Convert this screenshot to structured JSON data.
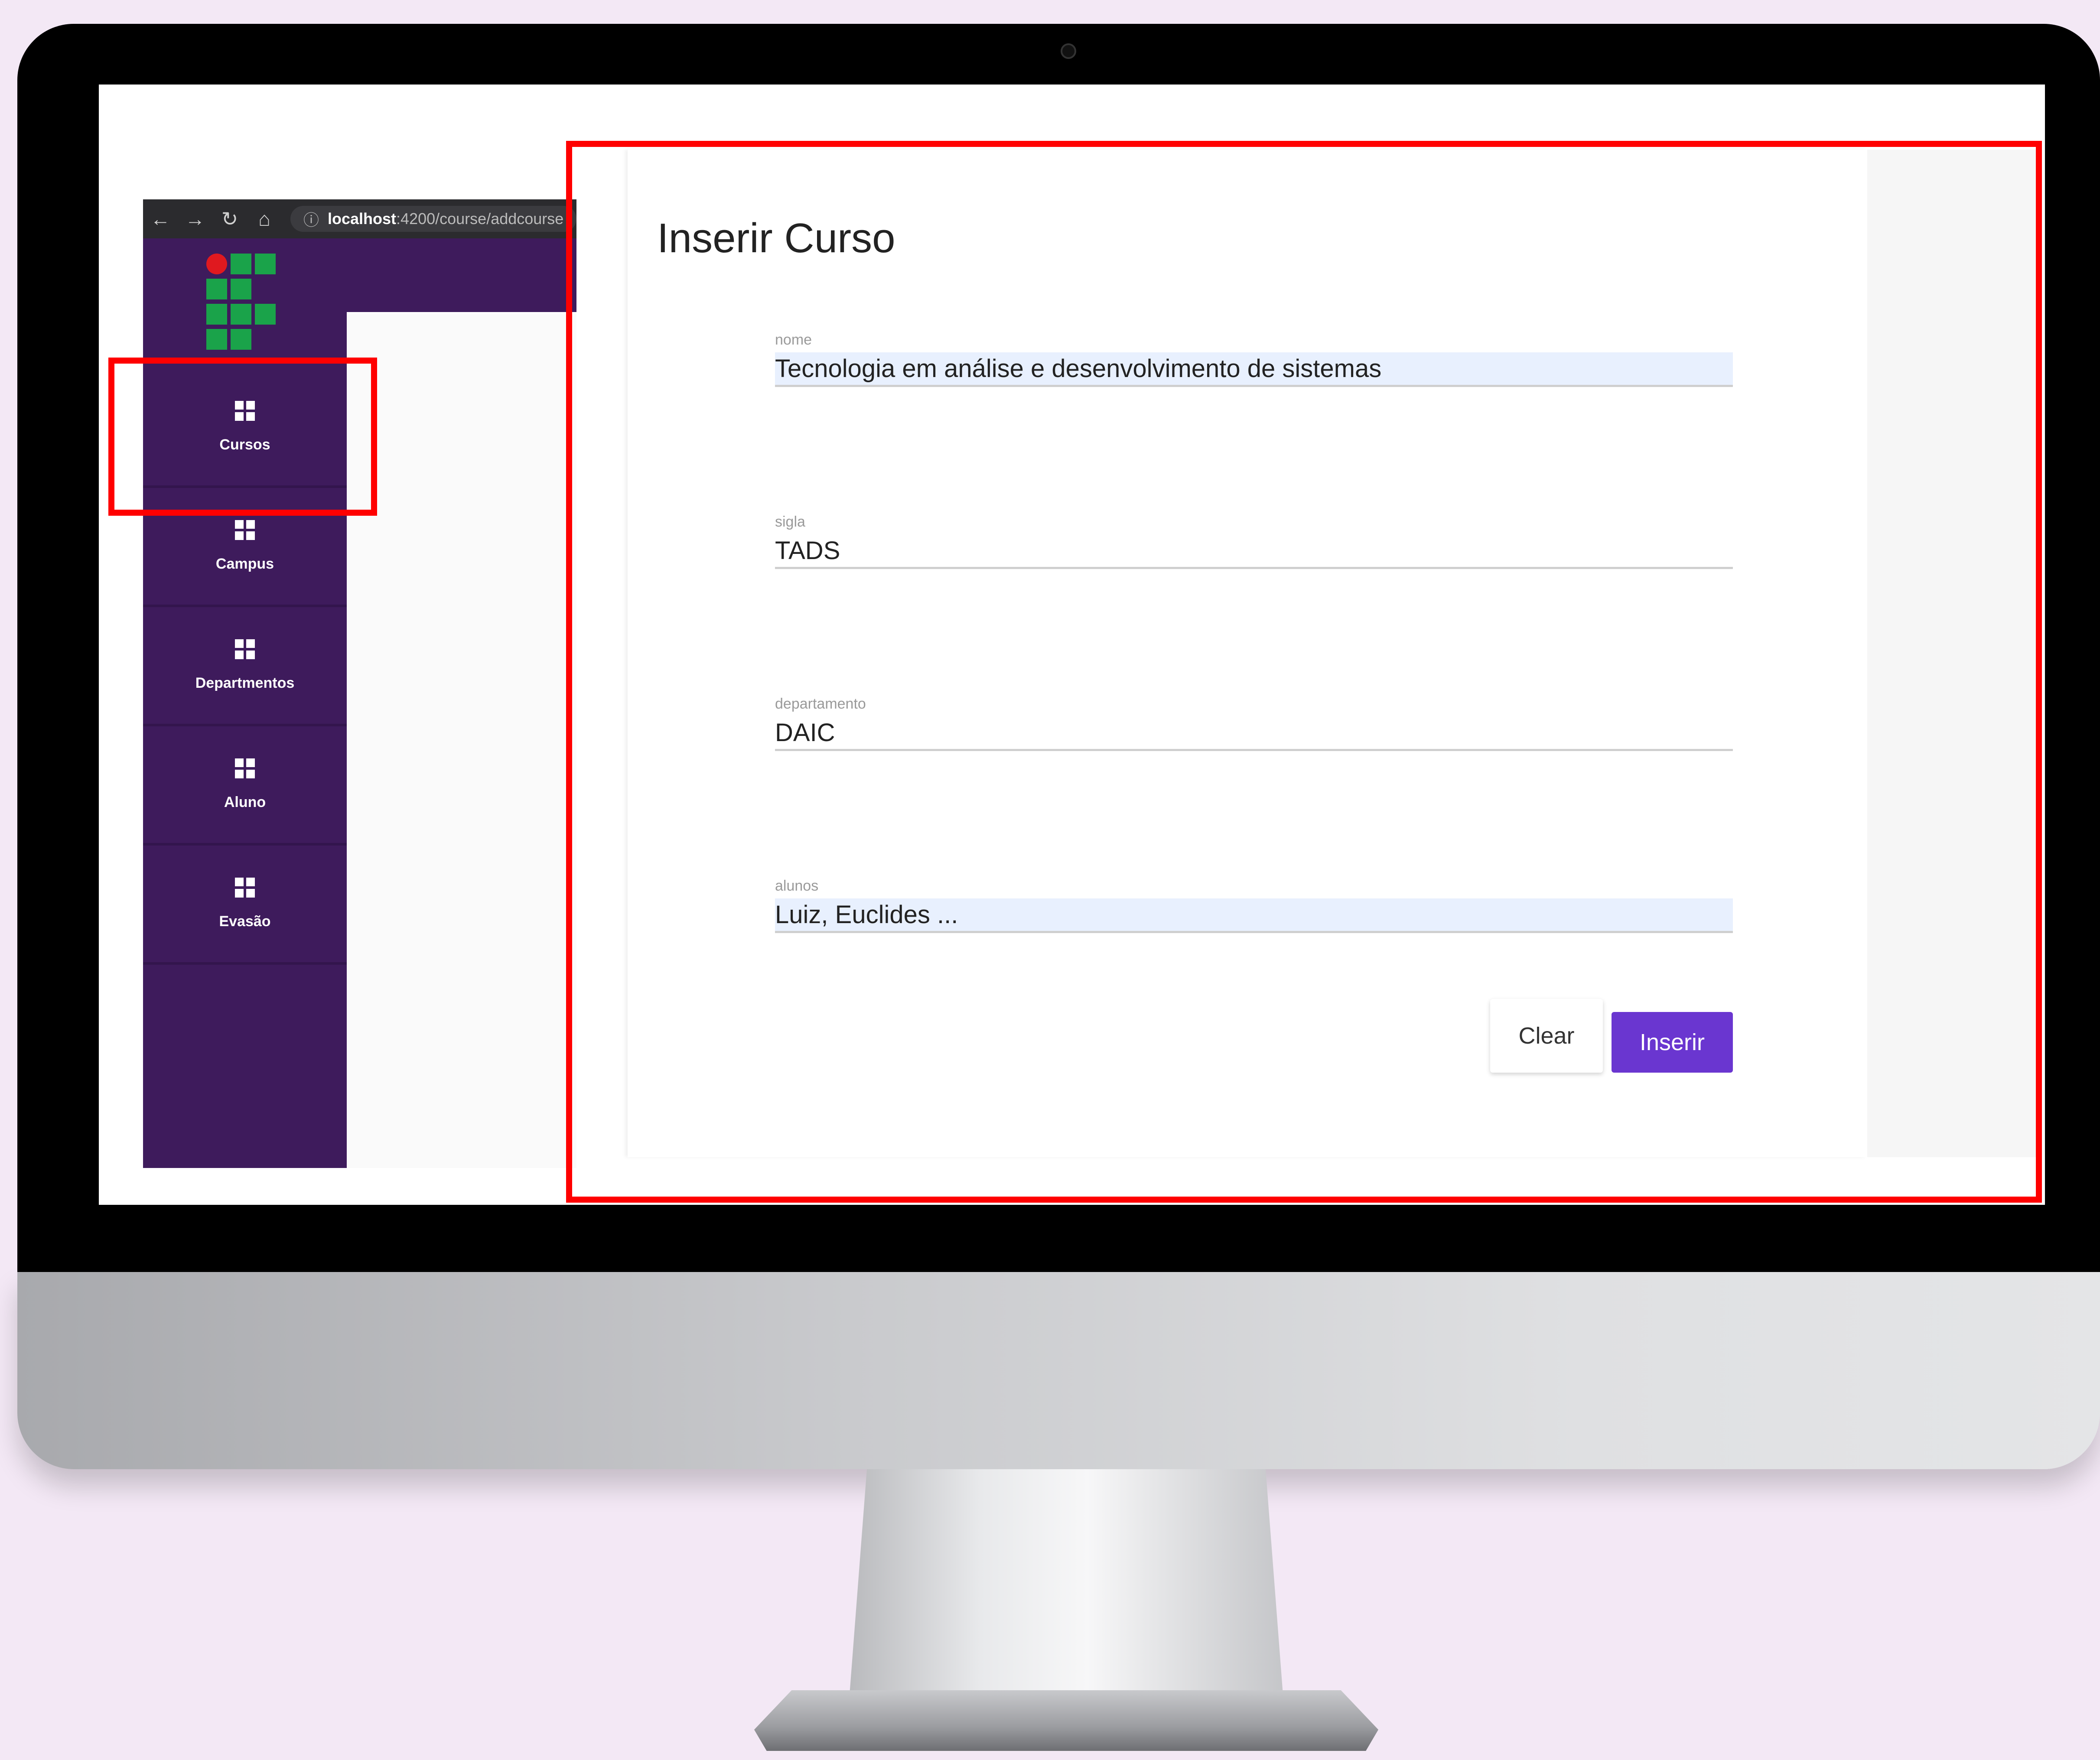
{
  "browser": {
    "url_bold": "localhost",
    "url_rest": ":4200/course/addcourse"
  },
  "sidebar": {
    "items": [
      {
        "label": "Cursos",
        "icon": "dashboard-icon"
      },
      {
        "label": "Campus",
        "icon": "dashboard-icon"
      },
      {
        "label": "Departmentos",
        "icon": "dashboard-icon"
      },
      {
        "label": "Aluno",
        "icon": "dashboard-icon"
      },
      {
        "label": "Evasão",
        "icon": "dashboard-icon"
      }
    ]
  },
  "form": {
    "title": "Inserir Curso",
    "fields": [
      {
        "label": "nome",
        "value": "Tecnologia em análise e desenvolvimento de sistemas"
      },
      {
        "label": "sigla",
        "value": "TADS"
      },
      {
        "label": "departamento",
        "value": "DAIC"
      },
      {
        "label": "alunos",
        "value": "Luiz, Euclides ..."
      }
    ],
    "clear_label": "Clear",
    "insert_label": "Inserir"
  },
  "colors": {
    "sidebar": "#3e1b5c",
    "accent": "#6a36d0",
    "highlight": "#ff0000",
    "logo_green": "#1aa34a",
    "logo_red": "#e0191f"
  }
}
